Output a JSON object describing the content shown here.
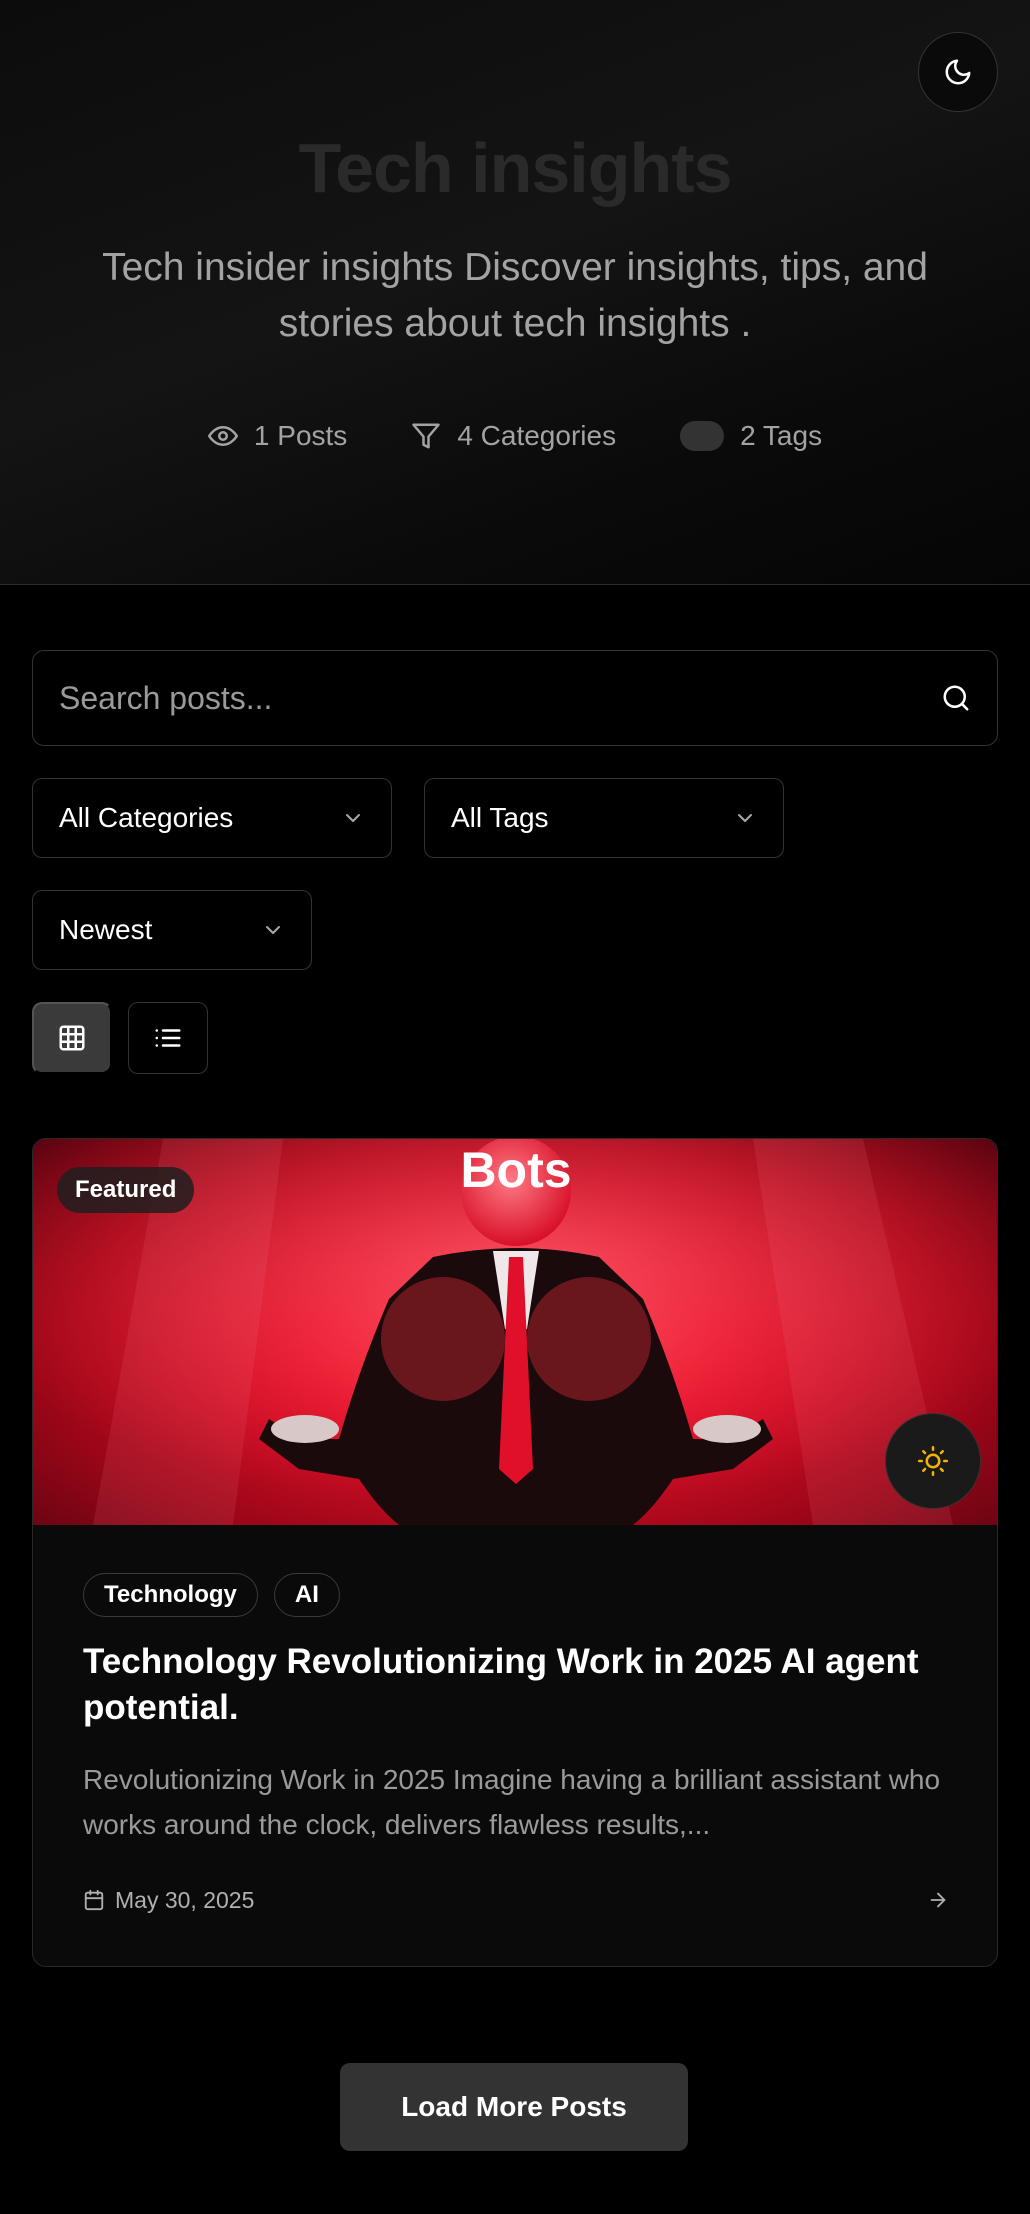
{
  "hero": {
    "title": "Tech insights",
    "subtitle": "Tech insider insights Discover insights, tips, and stories about tech insights .",
    "stats": {
      "posts": "1 Posts",
      "categories": "4 Categories",
      "tags": "2 Tags"
    }
  },
  "search": {
    "placeholder": "Search posts..."
  },
  "filters": {
    "category": "All Categories",
    "tags": "All Tags",
    "sort": "Newest"
  },
  "posts": [
    {
      "badge": "Featured",
      "image_text": "Bots",
      "categories": [
        "Technology",
        "AI"
      ],
      "title": "Technology Revolutionizing Work in 2025 AI agent potential.",
      "excerpt": "Revolutionizing Work in 2025 Imagine having a brilliant assistant who works around the clock, delivers flawless results,...",
      "date": "May 30, 2025"
    }
  ],
  "load_more": "Load More Posts",
  "icons": {
    "theme_toggle": "moon-icon",
    "posts_stat": "eye-icon",
    "categories_stat": "filter-icon",
    "search": "search-icon",
    "grid_view": "grid-icon",
    "list_view": "list-icon",
    "date": "calendar-icon",
    "read_more": "arrow-right-icon",
    "card_theme": "sun-icon"
  },
  "colors": {
    "background": "#000000",
    "accent_sun": "#f5b400",
    "image_red": "#e0102a"
  }
}
